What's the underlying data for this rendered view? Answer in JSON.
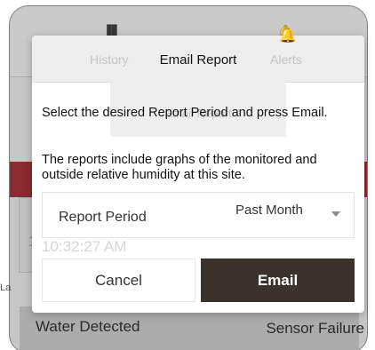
{
  "background": {
    "nav": {
      "history": "History",
      "alerts": "Alerts"
    },
    "email_card": "Email Report",
    "time": "10:32:27 AM",
    "last_label": "La",
    "bottom_left": "Water Detected",
    "bottom_right": "Sensor Failure"
  },
  "modal": {
    "title": "Email Report",
    "message1": "Select the desired Report Period and press Email.",
    "message2": "The reports include graphs of the monitored and outside relative humidity at this site.",
    "period_label": "Report Period",
    "period_value": "Past Month",
    "cancel": "Cancel",
    "email": "Email"
  },
  "colors": {
    "accent_dark": "#3a322b",
    "alert_red": "#a8353c"
  },
  "icons": {
    "history": "bar-chart-icon",
    "alerts": "bell-icon",
    "email": "envelope-icon",
    "dropdown": "chevron-down-icon"
  }
}
